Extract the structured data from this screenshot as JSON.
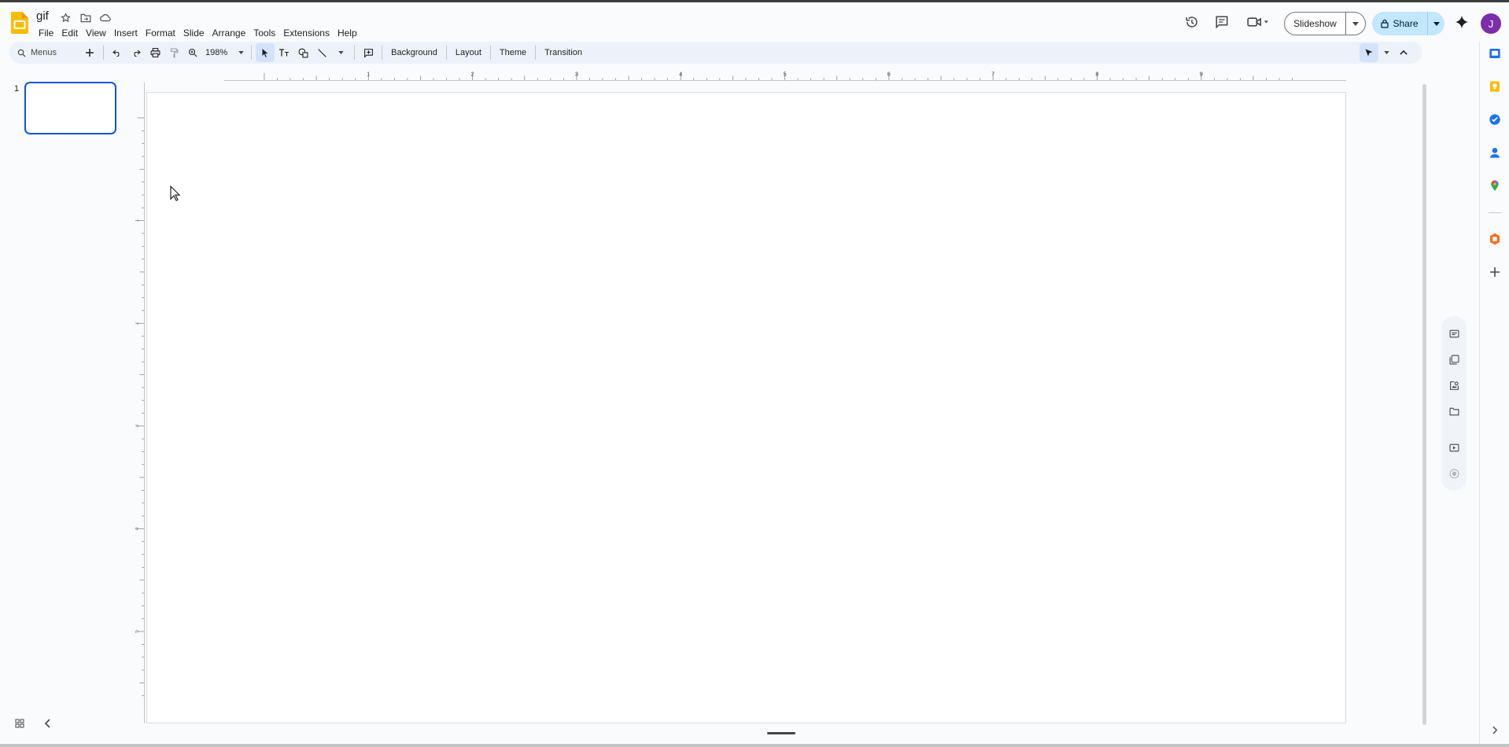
{
  "document": {
    "title": "gif"
  },
  "menubar": [
    "File",
    "Edit",
    "View",
    "Insert",
    "Format",
    "Slide",
    "Arrange",
    "Tools",
    "Extensions",
    "Help"
  ],
  "header": {
    "slideshow_label": "Slideshow",
    "share_label": "Share",
    "avatar_initial": "J",
    "icons": [
      "history-icon",
      "comments-icon",
      "meet-icon",
      "gemini-icon"
    ]
  },
  "toolbar": {
    "search_placeholder": "Menus",
    "zoom": "198%",
    "background_label": "Background",
    "layout_label": "Layout",
    "theme_label": "Theme",
    "transition_label": "Transition"
  },
  "filmstrip": {
    "slides": [
      {
        "number": "1"
      }
    ]
  },
  "ruler": {
    "horizontal_ticks": [
      "1",
      "2",
      "3",
      "4",
      "5",
      "6",
      "7",
      "8",
      "9"
    ],
    "vertical_ticks": [
      "1",
      "2",
      "3",
      "4",
      "5"
    ]
  },
  "side_apps": [
    "slides-app-icon",
    "keep-icon",
    "tasks-icon",
    "contacts-icon",
    "maps-icon",
    "office-addon-icon",
    "add-icon"
  ],
  "quick_panel": [
    "speaker-notes-icon",
    "layers-icon",
    "image-search-icon",
    "folder-icon",
    "present-icon",
    "record-icon"
  ],
  "colors": {
    "accent": "#0b57d0",
    "share_bg": "#c2e7ff",
    "toolbar_bg": "#edf2fa",
    "avatar_bg": "#7b2fa8",
    "slides_logo": "#fbbc04"
  }
}
